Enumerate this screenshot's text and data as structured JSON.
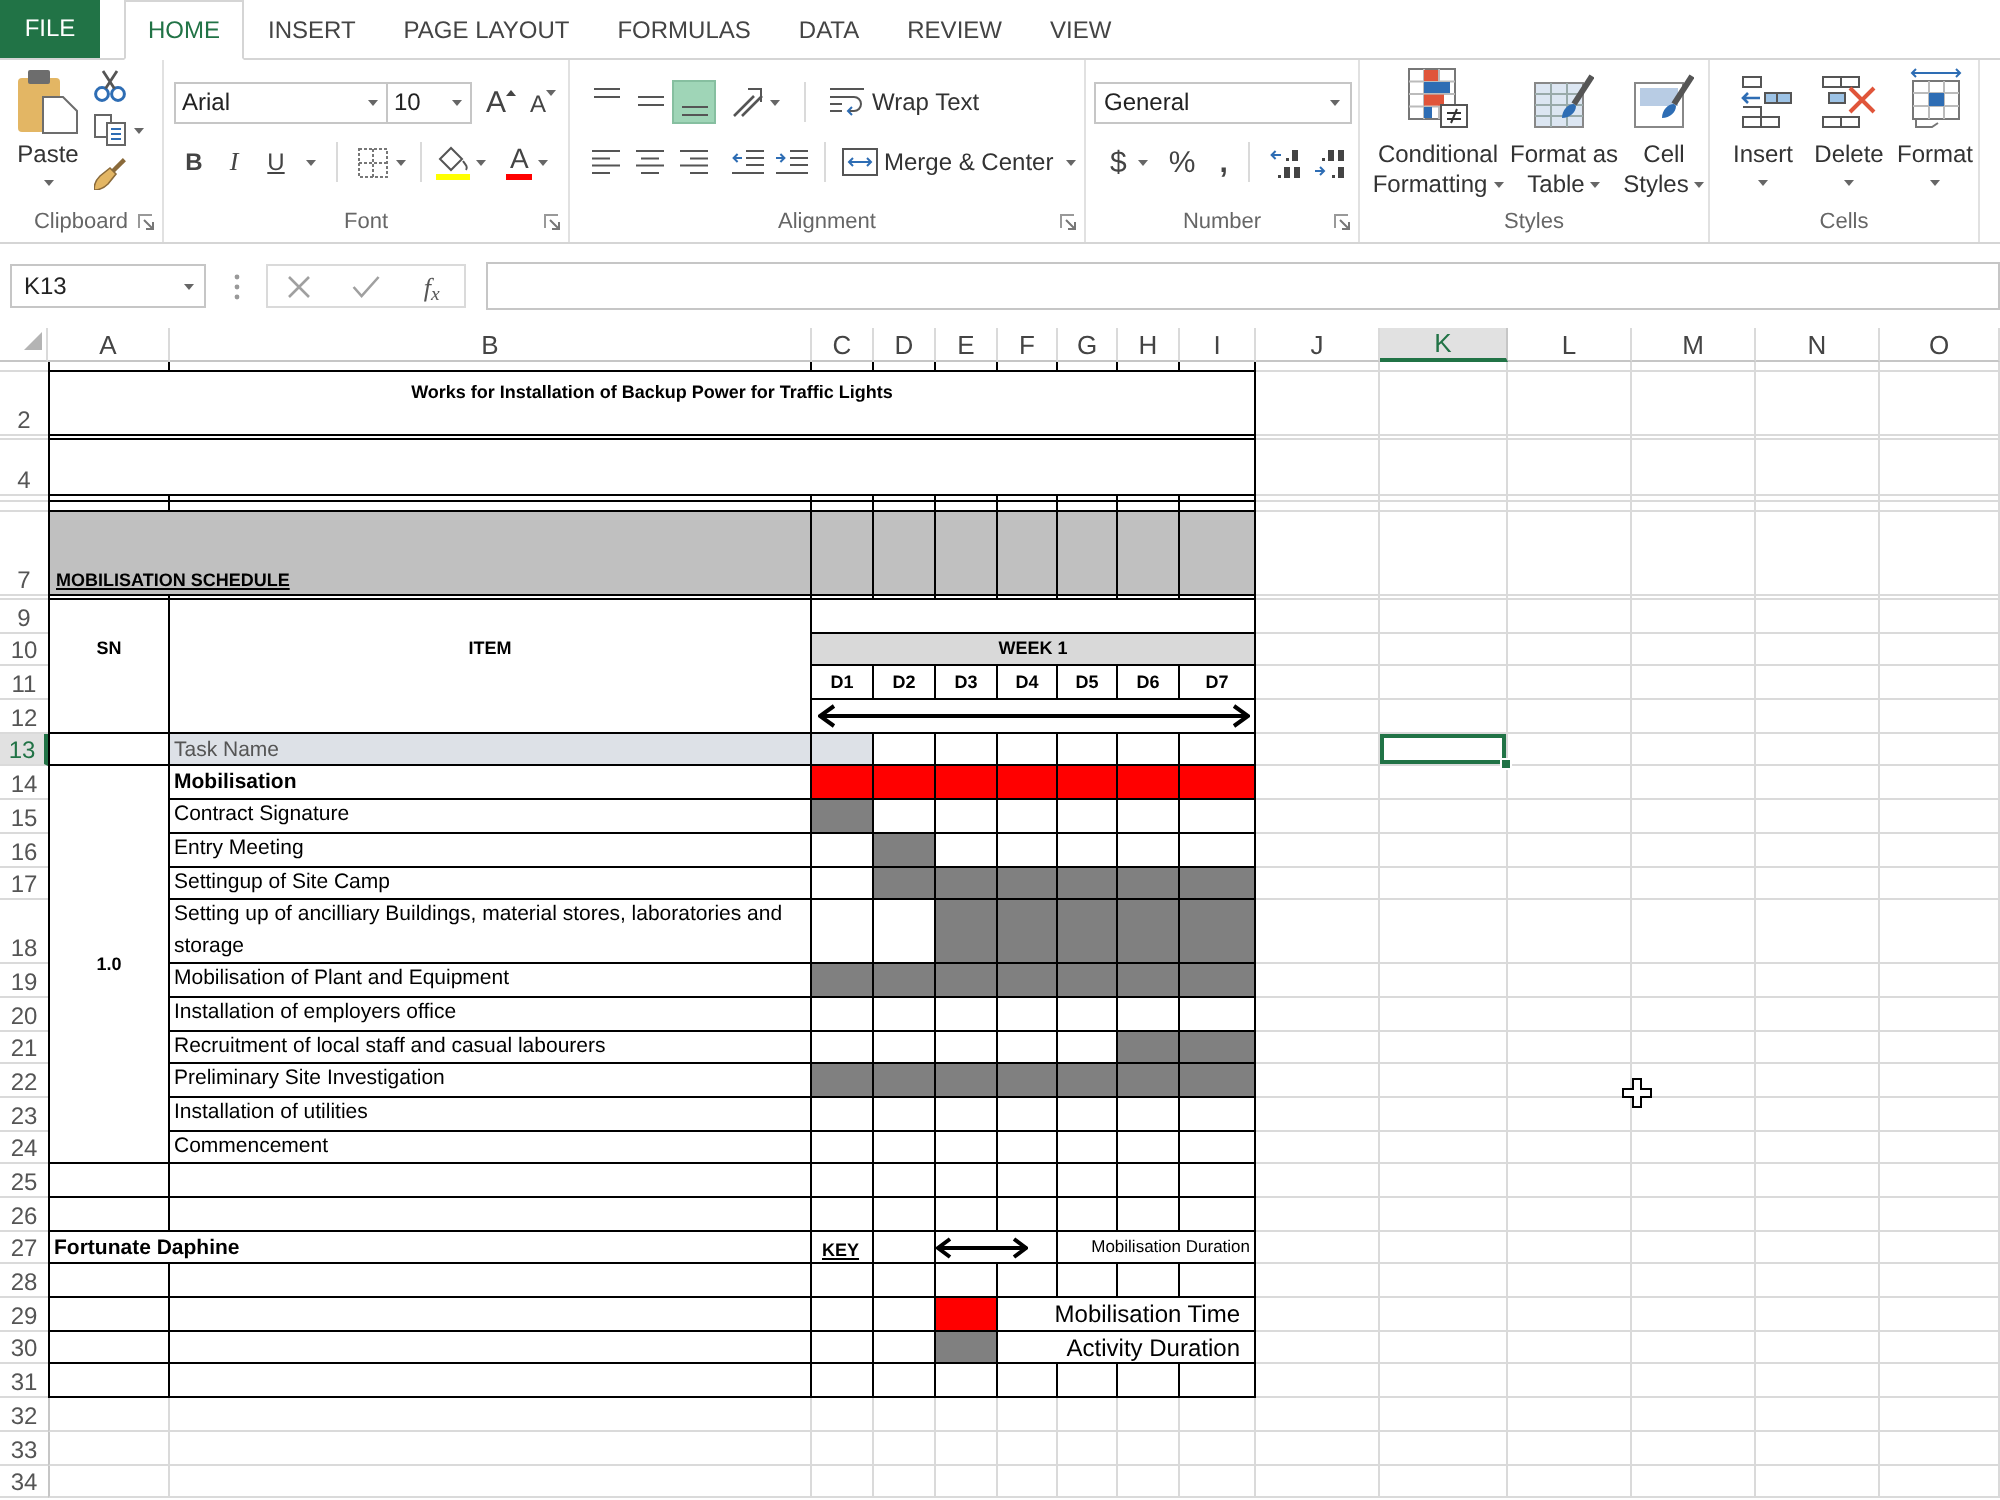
{
  "tabs": [
    {
      "label": "FILE",
      "kind": "file",
      "selected": false
    },
    {
      "label": "HOME",
      "kind": "tab",
      "selected": true
    },
    {
      "label": "INSERT",
      "kind": "tab",
      "selected": false
    },
    {
      "label": "PAGE LAYOUT",
      "kind": "tab",
      "selected": false
    },
    {
      "label": "FORMULAS",
      "kind": "tab",
      "selected": false
    },
    {
      "label": "DATA",
      "kind": "tab",
      "selected": false
    },
    {
      "label": "REVIEW",
      "kind": "tab",
      "selected": false
    },
    {
      "label": "VIEW",
      "kind": "tab",
      "selected": false
    }
  ],
  "ribbon": {
    "clipboard": {
      "label": "Clipboard",
      "paste": "Paste"
    },
    "font": {
      "label": "Font",
      "font_name": "Arial",
      "font_size": "10",
      "grow": "A",
      "shrink": "A",
      "bold": "B",
      "italic": "I",
      "underline": "U",
      "font_color": "A"
    },
    "alignment": {
      "label": "Alignment",
      "vertical": [
        {
          "kind": "top",
          "selected": false
        },
        {
          "kind": "middle",
          "selected": false
        },
        {
          "kind": "bottom",
          "selected": true
        }
      ],
      "wrap_text": "Wrap Text",
      "merge": "Merge & Center"
    },
    "number": {
      "label": "Number",
      "format": "General",
      "currency": "$",
      "percent": "%",
      "comma": ","
    },
    "styles": {
      "label": "Styles",
      "buttons": [
        "Conditional Formatting",
        "Format as Table",
        "Cell Styles"
      ]
    },
    "cells": {
      "label": "Cells",
      "buttons": [
        "Insert",
        "Delete",
        "Format"
      ]
    }
  },
  "formula_bar": {
    "name_box": "K13",
    "function": "f$_{x}$"
  },
  "columns": [
    {
      "label": "A",
      "selected": false
    },
    {
      "label": "B",
      "selected": false
    },
    {
      "label": "C",
      "selected": false
    },
    {
      "label": "D",
      "selected": false
    },
    {
      "label": "E",
      "selected": false
    },
    {
      "label": "F",
      "selected": false
    },
    {
      "label": "G",
      "selected": false
    },
    {
      "label": "H",
      "selected": false
    },
    {
      "label": "I",
      "selected": false
    },
    {
      "label": "J",
      "selected": false
    },
    {
      "label": "K",
      "selected": true
    },
    {
      "label": "L",
      "selected": false
    },
    {
      "label": "M",
      "selected": false
    },
    {
      "label": "N",
      "selected": false
    },
    {
      "label": "O",
      "selected": false
    }
  ],
  "rows": [
    {
      "label": "2",
      "selected": false
    },
    {
      "label": "4",
      "selected": false
    },
    {
      "label": "7",
      "selected": false
    },
    {
      "label": "9",
      "selected": false
    },
    {
      "label": "10",
      "selected": false
    },
    {
      "label": "11",
      "selected": false
    },
    {
      "label": "12",
      "selected": false
    },
    {
      "label": "13",
      "selected": true
    },
    {
      "label": "14",
      "selected": false
    },
    {
      "label": "15",
      "selected": false
    },
    {
      "label": "16",
      "selected": false
    },
    {
      "label": "17",
      "selected": false
    },
    {
      "label": "18",
      "selected": false
    },
    {
      "label": "19",
      "selected": false
    },
    {
      "label": "20",
      "selected": false
    },
    {
      "label": "21",
      "selected": false
    },
    {
      "label": "22",
      "selected": false
    },
    {
      "label": "23",
      "selected": false
    },
    {
      "label": "24",
      "selected": false
    },
    {
      "label": "25",
      "selected": false
    },
    {
      "label": "26",
      "selected": false
    },
    {
      "label": "27",
      "selected": false
    },
    {
      "label": "28",
      "selected": false
    },
    {
      "label": "29",
      "selected": false
    },
    {
      "label": "30",
      "selected": false
    },
    {
      "label": "31",
      "selected": false
    },
    {
      "label": "32",
      "selected": false
    },
    {
      "label": "33",
      "selected": false
    },
    {
      "label": "34",
      "selected": false
    }
  ],
  "sheet": {
    "title": "Works for Installation of Backup Power for Traffic Lights",
    "section": "MOBILISATION SCHEDULE",
    "sn_header": "SN",
    "item_header": "ITEM",
    "week": "WEEK 1",
    "days": [
      "D1",
      "D2",
      "D3",
      "D4",
      "D5",
      "D6",
      "D7"
    ],
    "task_header": "Task Name",
    "group": {
      "sn": "1.0",
      "tasks": [
        {
          "name": "Mobilisation",
          "kind": "mobilisation",
          "filled": [
            true,
            true,
            true,
            true,
            true,
            true,
            true
          ]
        },
        {
          "name": "Contract Signature",
          "kind": "activity",
          "filled": [
            true,
            false,
            false,
            false,
            false,
            false,
            false
          ]
        },
        {
          "name": "Entry Meeting",
          "kind": "activity",
          "filled": [
            false,
            true,
            false,
            false,
            false,
            false,
            false
          ]
        },
        {
          "name": "Settingup of Site Camp",
          "kind": "activity",
          "filled": [
            false,
            true,
            true,
            true,
            true,
            true,
            true
          ]
        },
        {
          "name": "Setting up of ancilliary Buildings, material stores, laboratories and storage",
          "kind": "activity",
          "filled": [
            false,
            false,
            true,
            true,
            true,
            true,
            true
          ]
        },
        {
          "name": "Mobilisation of Plant and Equipment",
          "kind": "activity",
          "filled": [
            true,
            true,
            true,
            true,
            true,
            true,
            true
          ]
        },
        {
          "name": "Installation of employers office",
          "kind": "activity",
          "filled": [
            false,
            false,
            false,
            false,
            false,
            false,
            false
          ]
        },
        {
          "name": "Recruitment of local staff and casual labourers",
          "kind": "activity",
          "filled": [
            false,
            false,
            false,
            false,
            false,
            true,
            true
          ]
        },
        {
          "name": "Preliminary Site Investigation",
          "kind": "activity",
          "filled": [
            true,
            true,
            true,
            true,
            true,
            true,
            true
          ]
        },
        {
          "name": "Installation of utilities",
          "kind": "activity",
          "filled": [
            false,
            false,
            false,
            false,
            false,
            false,
            false
          ]
        },
        {
          "name": "Commencement",
          "kind": "activity",
          "filled": [
            false,
            false,
            false,
            false,
            false,
            false,
            false
          ]
        }
      ]
    },
    "author": "Fortunate Daphine",
    "key_title": "KEY",
    "key": [
      {
        "kind": "duration",
        "label": "Mobilisation Duration"
      },
      {
        "kind": "mobilisation",
        "label": "Mobilisation Time"
      },
      {
        "kind": "activity",
        "label": "Activity Duration"
      }
    ]
  }
}
